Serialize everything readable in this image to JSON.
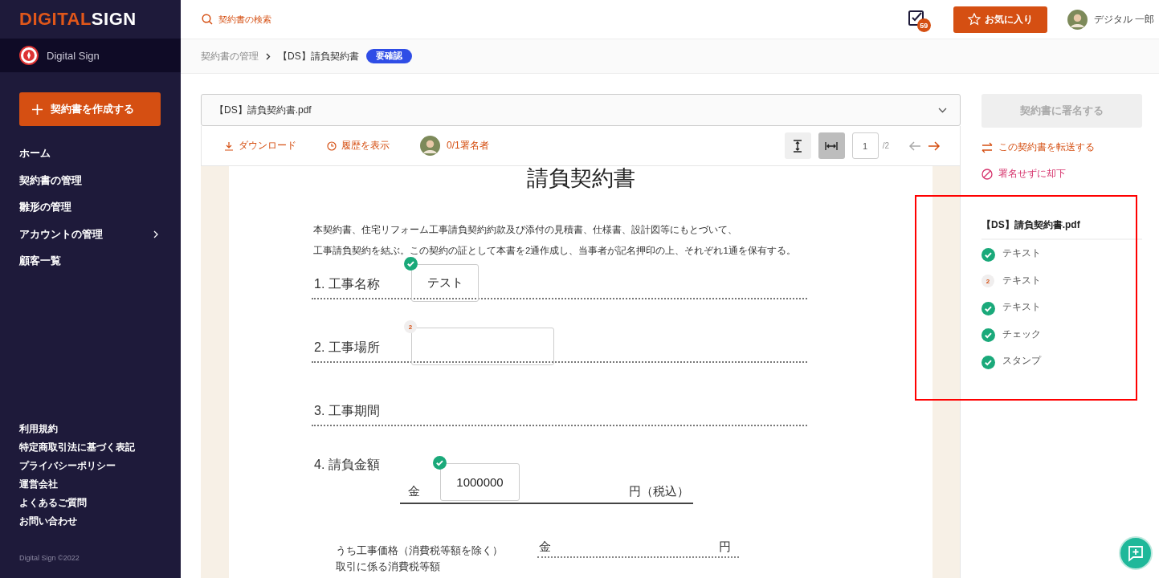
{
  "sidebar": {
    "logo": {
      "part_1": "DIGITAL",
      "part_2": "SIGN"
    },
    "organization": "Digital Sign",
    "create_button": "契約書を作成する",
    "nav": [
      {
        "label": "ホーム",
        "kind": "link"
      },
      {
        "label": "契約書の管理",
        "kind": "link"
      },
      {
        "label": "雛形の管理",
        "kind": "link"
      },
      {
        "label": "アカウントの管理",
        "kind": "submenu"
      },
      {
        "label": "顧客一覧",
        "kind": "link"
      }
    ],
    "footer_links": [
      "利用規約",
      "特定商取引法に基づく表記",
      "プライバシーポリシー",
      "運営会社",
      "よくあるご質問",
      "お問い合わせ"
    ],
    "copyright": "Digital Sign ©2022"
  },
  "header": {
    "search": {
      "placeholder": "契約書の検索"
    },
    "task_count": "59",
    "favorites_button": "お気に入り",
    "user_name": "デジタル 一郎"
  },
  "breadcrumb": {
    "items": [
      "契約書の管理",
      "【DS】請負契約書"
    ],
    "badge": "要確認"
  },
  "document": {
    "file_select": "【DS】請負契約書.pdf",
    "toolbar": {
      "download": "ダウンロード",
      "history": "履歴を表示",
      "signers": "0/1署名者",
      "fit_buttons": [
        {
          "kind": "fit-height",
          "selected": false
        },
        {
          "kind": "fit-width",
          "selected": true
        }
      ],
      "page": "1",
      "page_total": "/2",
      "prev_disabled": true,
      "next_disabled": false
    },
    "title": "請負契約書",
    "paragraph": [
      "本契約書、住宅リフォーム工事請負契約約款及び添付の見積書、仕様書、設計図等にもとづいて、",
      "工事請負契約を結ぶ。この契約の証として本書を2通作成し、当事者が記名押印の上、それぞれ1通を保有する。"
    ],
    "items": [
      {
        "kind": "field",
        "number": "1.",
        "label": "工事名称",
        "value": "テスト",
        "completed": true
      },
      {
        "kind": "field",
        "number": "2.",
        "label": "工事場所",
        "completed": false,
        "badge": "2"
      },
      {
        "kind": "plain",
        "number": "3.",
        "label": "工事期間"
      },
      {
        "kind": "amount",
        "number": "4.",
        "label": "請負金額",
        "prefix": "金",
        "value": "1000000",
        "suffix": "円（税込）",
        "completed": true
      }
    ],
    "sub_rows": [
      {
        "label": "うち工事価格（消費税等額を除く）",
        "prefix": "金",
        "suffix": "円"
      },
      {
        "label": "取引に係る消費税等額"
      }
    ]
  },
  "actions": {
    "sign_button": {
      "label": "契約書に署名する",
      "disabled": true
    },
    "forward_link": "この契約書を転送する",
    "reject_link": "署名せずに却下"
  },
  "field_list": {
    "title": "【DS】請負契約書.pdf",
    "items": [
      {
        "label": "テキスト",
        "completed": true
      },
      {
        "label": "テキスト",
        "completed": false,
        "badge": "2"
      },
      {
        "label": "テキスト",
        "completed": true
      },
      {
        "label": "チェック",
        "completed": true
      },
      {
        "label": "スタンプ",
        "completed": true
      }
    ]
  }
}
